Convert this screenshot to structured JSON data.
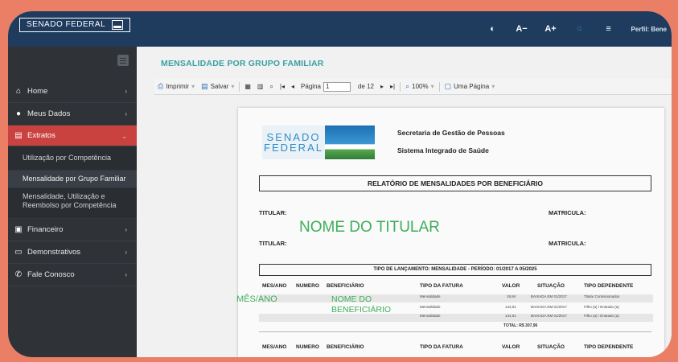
{
  "header": {
    "logo_text": "SENADO FEDERAL",
    "tools": [
      "◐",
      "A−",
      "A+",
      "○",
      "≡"
    ],
    "perfil": "Perfil: Bene"
  },
  "sidebar": {
    "items": [
      {
        "label": "Home",
        "icon": "home-icon"
      },
      {
        "label": "Meus Dados",
        "icon": "user-icon"
      },
      {
        "label": "Extratos",
        "icon": "document-icon"
      },
      {
        "label": "Financeiro",
        "icon": "money-icon"
      },
      {
        "label": "Demonstrativos",
        "icon": "print-icon"
      },
      {
        "label": "Fale Conosco",
        "icon": "phone-icon"
      }
    ],
    "sub_items": [
      "Utilização por Competência",
      "Mensalidade por Grupo Familiar",
      "Mensalidade, Utilização e Reembolso por Competência"
    ]
  },
  "main": {
    "page_title": "MENSALIDADE POR GRUPO FAMILIAR",
    "toolbar": {
      "print": "Imprimir",
      "save": "Salvar",
      "page_label": "Página",
      "page_value": "1",
      "page_of": "de 12",
      "zoom": "100%",
      "view": "Uma Página"
    }
  },
  "report": {
    "logo_line1": "SENADO",
    "logo_line2": "FEDERAL",
    "org_line1": "Secretaria de Gestão de Pessoas",
    "org_line2": "Sistema Integrado de Saúde",
    "title": "RELATÓRIO DE MENSALIDADES POR BENEFICIÁRIO",
    "titular_label": "TITULAR:",
    "matricula_label": "MATRICULA:",
    "overlay_titular": "NOME DO TITULAR",
    "overlay_mes": "MÊS/ANO",
    "overlay_benef_1": "NOME DO",
    "overlay_benef_2": "BENEFICIÁRIO",
    "lancamento": "TIPO DE LANÇAMENTO: MENSALIDADE - PERÍODO: 01/2017 A 05/2025",
    "columns": [
      "MES/ANO",
      "NUMERO",
      "BENEFICIÁRIO",
      "TIPO DA FATURA",
      "VALOR",
      "SITUAÇÃO",
      "TIPO DEPENDENTE"
    ],
    "rows": [
      {
        "tipo": "Mensalidade",
        "valor": "19,94",
        "situacao": "BAIXADA EM 01/2017",
        "dependente": "Titular Comissionados"
      },
      {
        "tipo": "Mensalidade",
        "valor": "144,01",
        "situacao": "BAIXADA EM 01/2017",
        "dependente": "Filho (a) / Enteado (a)"
      },
      {
        "tipo": "Mensalidade",
        "valor": "144,01",
        "situacao": "BAIXADA EM 01/2017",
        "dependente": "Filho (a) / Enteado (a)"
      }
    ],
    "total": "TOTAL: R$ 307,96"
  }
}
